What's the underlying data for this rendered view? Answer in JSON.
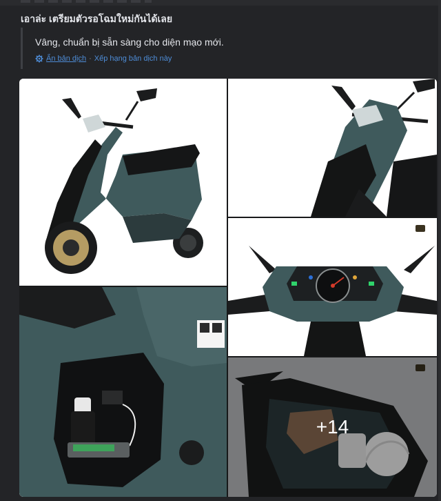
{
  "post": {
    "original_text": "เอาล่ะ เตรียมตัวรอโฉมใหม่กันได้เลย",
    "translation": {
      "text": "Vâng, chuẩn bị sẵn sàng cho diện mạo mới.",
      "hide_link": "Ẩn bản dịch",
      "separator": "·",
      "rate_link": "Xếp hạng bản dịch này"
    }
  },
  "gallery": {
    "extra_count_label": "+14",
    "photos": [
      {
        "icon": "scooter-side-view"
      },
      {
        "icon": "scooter-front-view"
      },
      {
        "icon": "scooter-dashboard"
      },
      {
        "icon": "scooter-storage-compartment"
      },
      {
        "icon": "scooter-under-seat-storage"
      }
    ]
  },
  "colors": {
    "background": "#232427",
    "link": "#4e8dd8",
    "scooter_body": "#3f5a5c"
  }
}
